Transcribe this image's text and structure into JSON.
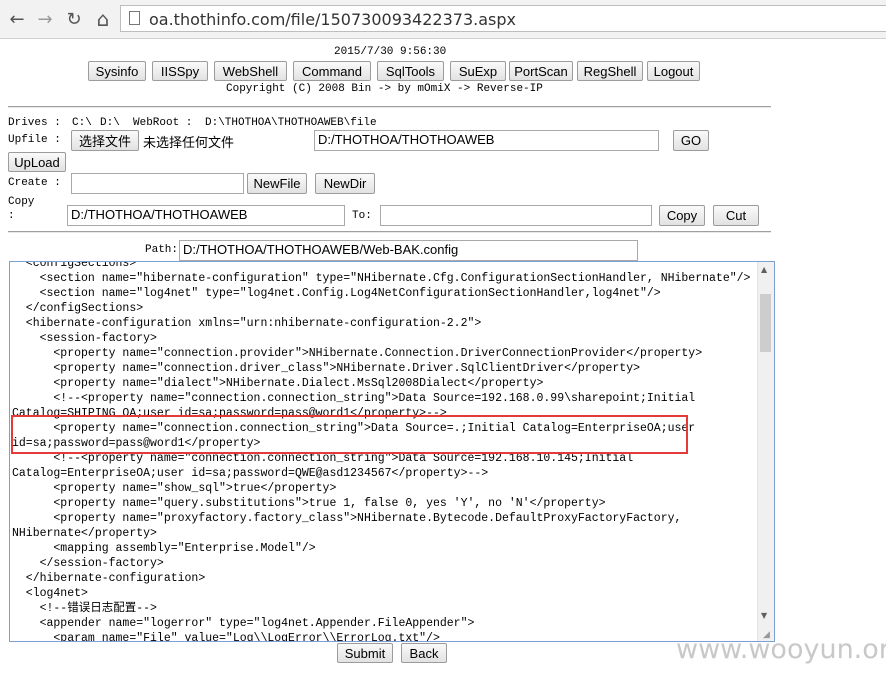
{
  "browser": {
    "back_icon": "back-arrow-icon",
    "forward_icon": "forward-arrow-icon",
    "reload_icon": "reload-icon",
    "home_icon": "home-icon",
    "url": "oa.thothinfo.com/file/150730093422373.aspx",
    "back_glyph": "←",
    "forward_glyph": "→",
    "reload_glyph": "↻",
    "home_glyph": "⌂"
  },
  "header": {
    "datetime": "2015/7/30 9:56:30",
    "copyright": "Copyright (C) 2008 Bin -> by mOmiX -> Reverse-IP"
  },
  "toolbar": {
    "sysinfo": "Sysinfo",
    "iisspy": "IISSpy",
    "webshell": "WebShell",
    "command": "Command",
    "sqltools": "SqlTools",
    "suexp": "SuExp",
    "portscan": "PortScan",
    "regshell": "RegShell",
    "logout": "Logout"
  },
  "drives": {
    "label": "Drives :",
    "c": "C:\\",
    "d": "D:\\",
    "webroot_label": "WebRoot :",
    "webroot_path": "D:\\THOTHOA\\THOTHOAWEB\\file"
  },
  "upfile": {
    "label": "Upfile :",
    "choose_button": "选择文件",
    "no_file": "未选择任何文件",
    "path_value": "D:/THOTHOA/THOTHOAWEB",
    "go_button": "GO",
    "upload_button": "UpLoad"
  },
  "create": {
    "label": "Create :",
    "value": "",
    "newfile_button": "NewFile",
    "newdir_button": "NewDir"
  },
  "copy": {
    "label": "Copy",
    "colon": ":",
    "from_value": "D:/THOTHOA/THOTHOAWEB",
    "to_label": "To:",
    "to_value": "",
    "copy_button": "Copy",
    "cut_button": "Cut"
  },
  "path": {
    "label": "Path:",
    "value": "D:/THOTHOA/THOTHOAWEB/Web-BAK.config"
  },
  "editor": {
    "lines": [
      "  <configSections>",
      "    <section name=\"hibernate-configuration\" type=\"NHibernate.Cfg.ConfigurationSectionHandler, NHibernate\"/>",
      "    <section name=\"log4net\" type=\"log4net.Config.Log4NetConfigurationSectionHandler,log4net\"/>",
      "  </configSections>",
      "  <hibernate-configuration xmlns=\"urn:nhibernate-configuration-2.2\">",
      "    <session-factory>",
      "      <property name=\"connection.provider\">NHibernate.Connection.DriverConnectionProvider</property>",
      "      <property name=\"connection.driver_class\">NHibernate.Driver.SqlClientDriver</property>",
      "      <property name=\"dialect\">NHibernate.Dialect.MsSql2008Dialect</property>",
      "      <!--<property name=\"connection.connection_string\">Data Source=192.168.0.99\\sharepoint;Initial",
      "Catalog=SHIPING_OA;user id=sa;password=pass@word1</property>-->",
      "      <property name=\"connection.connection_string\">Data Source=.;Initial Catalog=EnterpriseOA;user",
      "id=sa;password=pass@word1</property>",
      "      <!--<property name=\"connection.connection_string\">Data Source=192.168.10.145;Initial",
      "Catalog=EnterpriseOA;user id=sa;password=QWE@asd1234567</property>-->",
      "      <property name=\"show_sql\">true</property>",
      "      <property name=\"query.substitutions\">true 1, false 0, yes 'Y', no 'N'</property>",
      "      <property name=\"proxyfactory.factory_class\">NHibernate.Bytecode.DefaultProxyFactoryFactory,",
      "NHibernate</property>",
      "      <mapping assembly=\"Enterprise.Model\"/>",
      "    </session-factory>",
      "  </hibernate-configuration>",
      "  <log4net>",
      "    <!--错误日志配置-->",
      "    <appender name=\"logerror\" type=\"log4net.Appender.FileAppender\">",
      "      <param name=\"File\" value=\"Log\\\\LogError\\\\ErrorLog.txt\"/>"
    ]
  },
  "footer": {
    "submit_button": "Submit",
    "back_button": "Back"
  },
  "watermark": "www.wooyun.org",
  "colors": {
    "highlight": "#e43a3a",
    "editor_border": "#7aa0d6",
    "watermark": "#c8c8c8"
  }
}
